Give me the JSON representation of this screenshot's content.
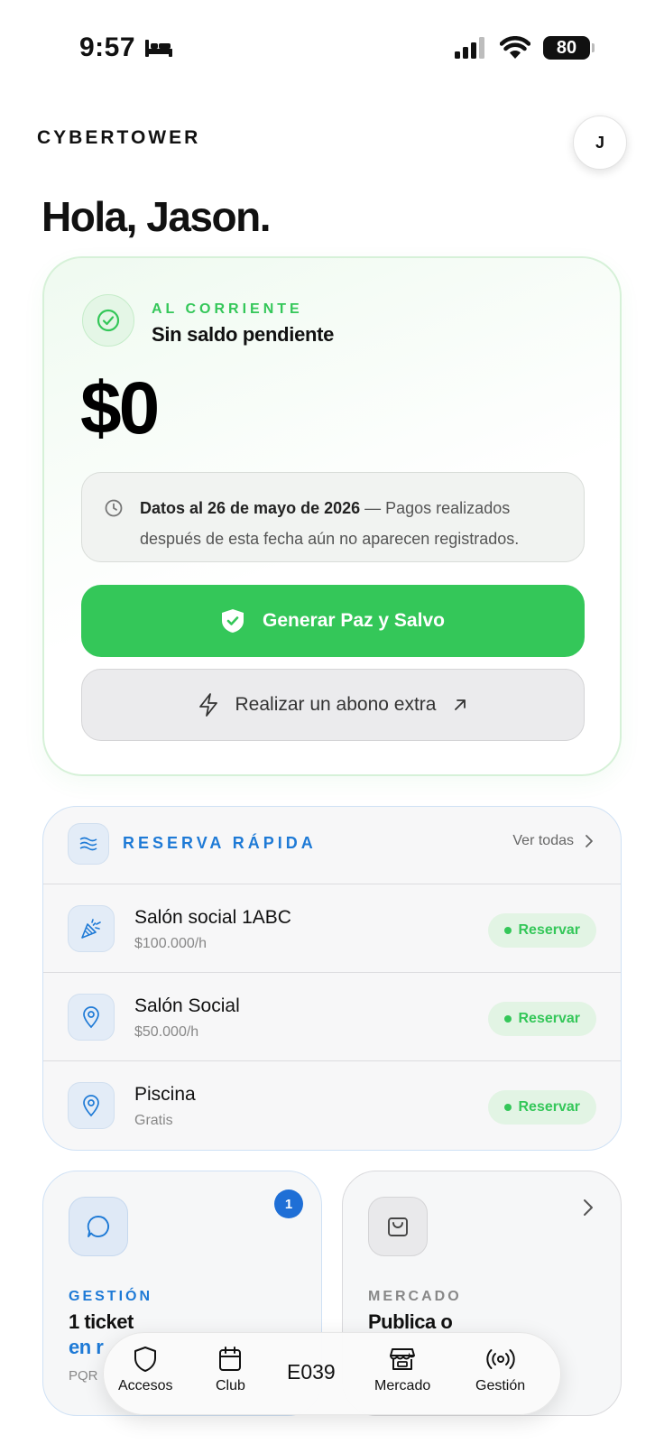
{
  "status_bar": {
    "time": "9:57",
    "battery": "80"
  },
  "header": {
    "brand": "CYBERTOWER",
    "avatar_initial": "J"
  },
  "greeting": "Hola, Jason.",
  "balance": {
    "status_label": "AL CORRIENTE",
    "status_sub": "Sin saldo pendiente",
    "amount": "$0",
    "info_bold": "Datos al 26 de mayo de 2026",
    "info_rest": " — Pagos realizados después de esta fecha aún no aparecen registrados.",
    "primary_button": "Generar Paz y Salvo",
    "secondary_button": "Realizar un abono extra"
  },
  "quick_reserve": {
    "title": "RESERVA RÁPIDA",
    "see_all": "Ver todas",
    "items": [
      {
        "name": "Salón social 1ABC",
        "price": "$100.000/h",
        "action": "Reservar",
        "icon": "party-popper-icon"
      },
      {
        "name": "Salón Social",
        "price": "$50.000/h",
        "action": "Reservar",
        "icon": "location-pin-icon"
      },
      {
        "name": "Piscina",
        "price": "Gratis",
        "action": "Reservar",
        "icon": "location-pin-icon"
      }
    ]
  },
  "tiles": {
    "gestion": {
      "label": "GESTIÓN",
      "main": "1 ticket",
      "accent": "en r",
      "sub": "PQR",
      "badge": "1",
      "icon": "chat-bubble-icon"
    },
    "mercado": {
      "label": "MERCADO",
      "main": "Publica o",
      "icon": "shopping-bag-icon"
    }
  },
  "nav": {
    "items": [
      {
        "label": "Accesos",
        "icon": "shield-icon"
      },
      {
        "label": "Club",
        "icon": "calendar-icon"
      },
      {
        "label": "Mercado",
        "icon": "storefront-icon"
      },
      {
        "label": "Gestión",
        "icon": "broadcast-icon"
      }
    ],
    "center_label": "E039"
  },
  "colors": {
    "green": "#34c759",
    "blue": "#1e7ad6",
    "badge_blue": "#1f6fd6"
  }
}
